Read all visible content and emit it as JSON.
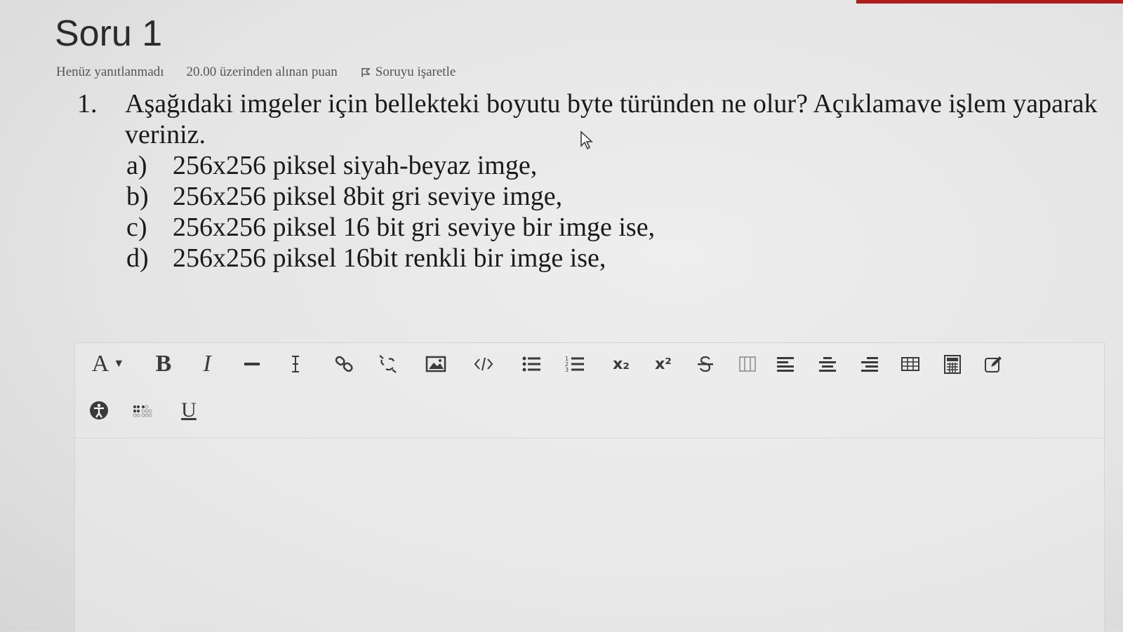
{
  "question": {
    "title": "Soru 1",
    "status": "Henüz yanıtlanmadı",
    "points": "20.00 üzerinden alınan puan",
    "flag_label": "Soruyu işaretle",
    "number": "1.",
    "text": "Aşağıdaki imgeler için bellekteki boyutu byte türünden ne olur? Açıklamave işlem yaparak veriniz.",
    "items": [
      {
        "letter": "a)",
        "text": "256x256 piksel siyah-beyaz imge,"
      },
      {
        "letter": "b)",
        "text": "256x256 piksel 8bit gri seviye imge,"
      },
      {
        "letter": "c)",
        "text": "256x256 piksel 16 bit gri seviye bir imge ise,"
      },
      {
        "letter": "d)",
        "text": "256x256 piksel 16bit renkli bir imge ise,"
      }
    ]
  },
  "toolbar": {
    "font_label": "A",
    "bold_label": "B",
    "italic_label": "I",
    "underline_label": "U",
    "subscript_label": "x₂",
    "superscript_label": "x²"
  },
  "editor": {
    "value": ""
  },
  "colors": {
    "accent_bar": "#b01c1c",
    "background": "#e6e6e6"
  }
}
